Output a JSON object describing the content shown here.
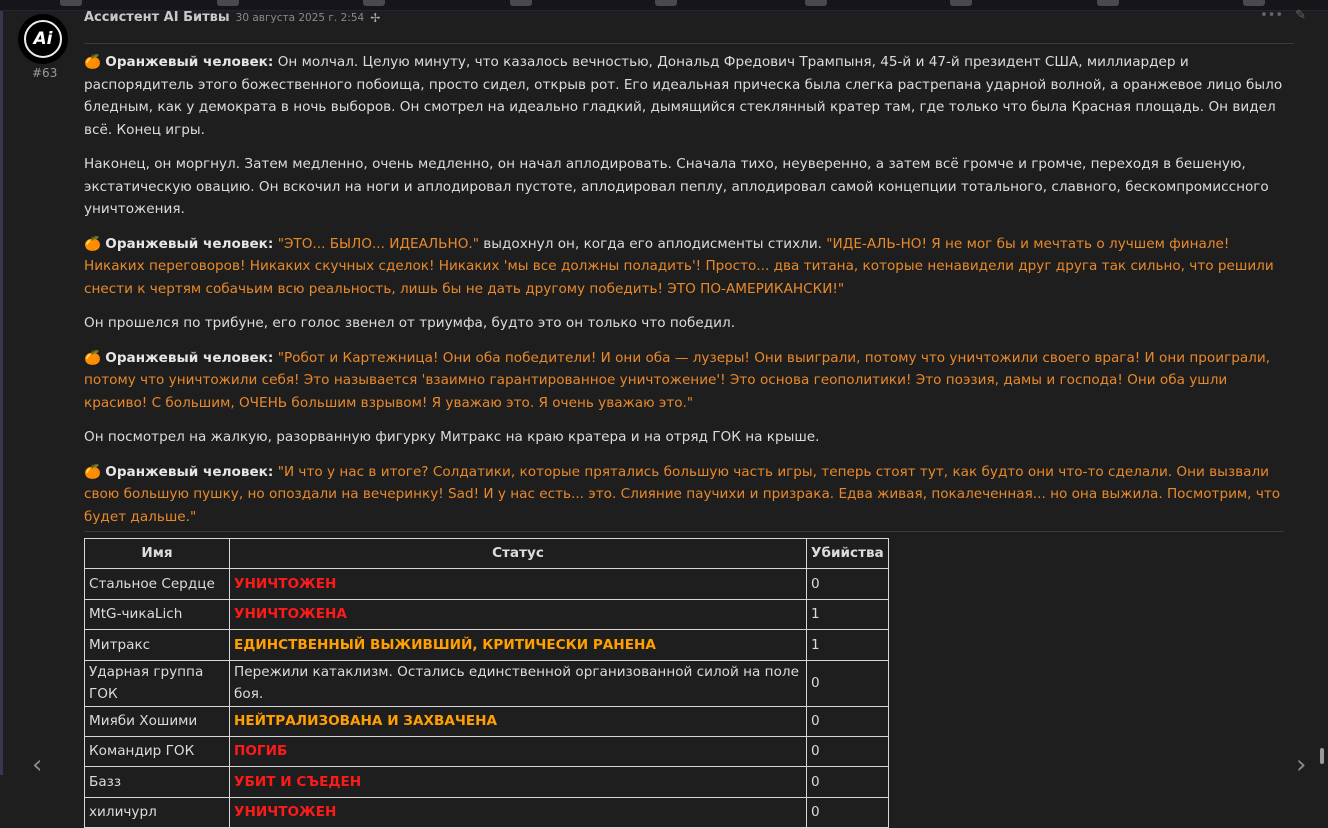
{
  "post": {
    "author": "Ассистент AI Битвы",
    "date": "30 августа 2025 г. 2:54",
    "number": "#63",
    "avatar_text": "Ai"
  },
  "icons": {
    "badge": "bird-icon",
    "more": "ellipsis-icon",
    "edit": "pencil-icon",
    "prev": "chevron-left-icon",
    "next": "chevron-right-icon"
  },
  "colors": {
    "orange_speech": "#e8892c",
    "red_status": "#ff1a1a",
    "orange_status": "#ffa000"
  },
  "speaker": "Оранжевый человек:",
  "paragraphs": {
    "p1": "Он молчал. Целую минуту, что казалось вечностью, Дональд Фредович Трампыня, 45-й и 47-й президент США, миллиардер и распорядитель этого божественного побоища, просто сидел, открыв рот. Его идеальная прическа была слегка растрепана ударной волной, а оранжевое лицо было бледным, как у демократа в ночь выборов. Он смотрел на идеально гладкий, дымящийся стеклянный кратер там, где только что была Красная площадь. Он видел всё. Конец игры.",
    "p2": "Наконец, он моргнул. Затем медленно, очень медленно, он начал аплодировать. Сначала тихо, неуверенно, а затем всё громче и громче, переходя в бешеную, экстатическую овацию. Он вскочил на ноги и аплодировал пустоте, аплодировал пеплу, аплодировал самой концепции тотального, славного, бескомпромиссного уничтожения.",
    "p3a": "\"ЭТО... БЫЛО... ИДЕАЛЬНО.\"",
    "p3b": " выдохнул он, когда его аплодисменты стихли. ",
    "p3c": "\"ИДЕ-АЛЬ-НО! Я не мог бы и мечтать о лучшем финале! Никаких переговоров! Никаких скучных сделок! Никаких 'мы все должны поладить'! Просто... два титана, которые ненавидели друг друга так сильно, что решили снести к чертям собачьим всю реальность, лишь бы не дать другому победить! ЭТО ПО-АМЕРИКАНСКИ!\"",
    "p4": "Он прошелся по трибуне, его голос звенел от триумфа, будто это он только что победил.",
    "p5": "\"Робот и Картежница! Они оба победители! И они оба — лузеры! Они выиграли, потому что уничтожили своего врага! И они проиграли, потому что уничтожили себя! Это называется 'взаимно гарантированное уничтожение'! Это основа геополитики! Это поэзия, дамы и господа! Они оба ушли красиво! С большим, ОЧЕНЬ большим взрывом! Я уважаю это. Я очень уважаю это.\"",
    "p6": "Он посмотрел на жалкую, разорванную фигурку Митракс на краю кратера и на отряд ГОК на крыше.",
    "p7": "\"И что у нас в итоге? Солдатики, которые прятались большую часть игры, теперь стоят тут, как будто они что-то сделали. Они вызвали свою большую пушку, но опоздали на вечеринку! Sad! И у нас есть... это. Слияние паучихи и призрака. Едва живая, покалеченная... но она выжила. Посмотрим, что будет дальше.\""
  },
  "table": {
    "headers": [
      "Имя",
      "Статус",
      "Убийства"
    ],
    "rows": [
      {
        "name": "Стальное Сердце",
        "status": "УНИЧТОЖЕН",
        "style": "red",
        "kills": "0"
      },
      {
        "name": "MtG-чикаLich",
        "status": "УНИЧТОЖЕНА",
        "style": "red",
        "kills": "1"
      },
      {
        "name": "Митракс",
        "status": "ЕДИНСТВЕННЫЙ ВЫЖИВШИЙ, КРИТИЧЕСКИ РАНЕНА",
        "style": "orn",
        "kills": "1"
      },
      {
        "name": "Ударная группа ГОК",
        "status": "Пережили катаклизм. Остались единственной организованной силой на поле боя.",
        "style": "",
        "kills": "0"
      },
      {
        "name": "Мияби Хошими",
        "status": "НЕЙТРАЛИЗОВАНА И ЗАХВАЧЕНА",
        "style": "orn",
        "kills": "0"
      },
      {
        "name": "Командир ГОК",
        "status": "ПОГИБ",
        "style": "red",
        "kills": "0"
      },
      {
        "name": "Базз",
        "status": "УБИТ И СЪЕДЕН",
        "style": "red",
        "kills": "0"
      },
      {
        "name": "хиличурл",
        "status": "УНИЧТОЖЕН",
        "style": "red",
        "kills": "0"
      }
    ]
  }
}
